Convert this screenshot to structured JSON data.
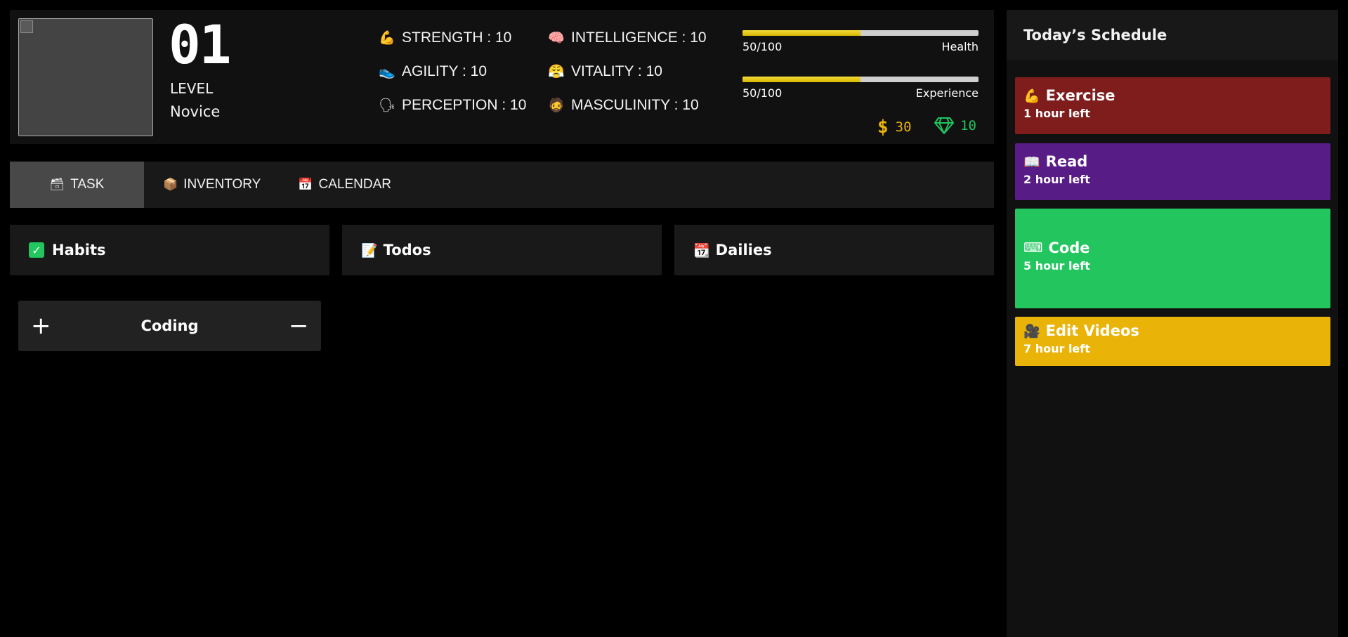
{
  "profile": {
    "level_number": "01",
    "level_label": "LEVEL",
    "rank": "Novice"
  },
  "stats": [
    {
      "icon": "💪",
      "icon_name": "flexed-biceps-icon",
      "label": "STRENGTH : 10"
    },
    {
      "icon": "🧠",
      "icon_name": "brain-icon",
      "label": "INTELLIGENCE : 10"
    },
    {
      "icon": "👟",
      "icon_name": "shoe-icon",
      "label": "AGILITY : 10"
    },
    {
      "icon": "😤",
      "icon_name": "huffing-face-icon",
      "label": "VITALITY : 10"
    },
    {
      "icon": "🗣",
      "icon_name": "speaking-head-icon",
      "label": "PERCEPTION : 10"
    },
    {
      "icon": "🧔",
      "icon_name": "bearded-person-icon",
      "label": "MASCULINITY : 10"
    }
  ],
  "bars": {
    "health": {
      "value_text": "50/100",
      "label": "Health",
      "fill_percent": 50
    },
    "experience": {
      "value_text": "50/100",
      "label": "Experience",
      "fill_percent": 50
    }
  },
  "currency": {
    "gold": {
      "symbol": "$",
      "amount": "30",
      "color": "#eab308"
    },
    "gems": {
      "amount": "10",
      "color": "#22c55e"
    }
  },
  "tabs": [
    {
      "icon": "🗃",
      "label": "TASK",
      "active": true
    },
    {
      "icon": "📦",
      "label": "INVENTORY",
      "active": false
    },
    {
      "icon": "📅",
      "label": "CALENDAR",
      "active": false
    }
  ],
  "columns": {
    "habits": {
      "icon": "✓",
      "label": "Habits"
    },
    "todos": {
      "icon": "📝",
      "label": "Todos"
    },
    "dailies": {
      "icon": "📆",
      "label": "Dailies"
    }
  },
  "habit": {
    "plus": "+",
    "name": "Coding",
    "minus": "−"
  },
  "schedule": {
    "title": "Today’s Schedule",
    "items": [
      {
        "icon": "💪",
        "title": "Exercise",
        "time": "1 hour left",
        "color": "#7f1d1d"
      },
      {
        "icon": "📖",
        "title": "Read",
        "time": "2 hour left",
        "color": "#581c87"
      },
      {
        "icon": "⌨",
        "title": "Code",
        "time": "5 hour left",
        "color": "#22c55e"
      },
      {
        "icon": "🎥",
        "title": "Edit Videos",
        "time": "7 hour left",
        "color": "#eab308"
      }
    ]
  }
}
